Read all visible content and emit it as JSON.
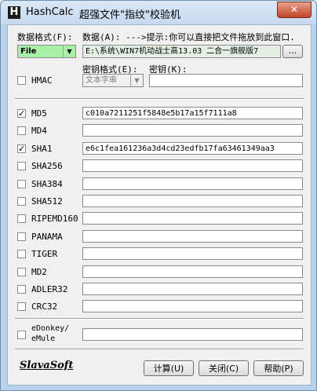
{
  "window": {
    "title": "HashCalc",
    "subtitle": "超强文件\"指纹\"校验机",
    "app_icon": "H",
    "close_glyph": "✕"
  },
  "data_format": {
    "label": "数据格式(F):",
    "value": "File"
  },
  "data": {
    "label": "数据(A): --->提示:你可以直接把文件拖放到此窗口.",
    "value": "E:\\系统\\WIN7机动战士高13.03 二合一旗舰版7",
    "browse_label": "..."
  },
  "hmac": {
    "label": "HMAC",
    "checked": false
  },
  "key_format": {
    "label": "密钥格式(E):",
    "value": "文本字串"
  },
  "key": {
    "label": "密钥(K):",
    "value": ""
  },
  "hashes": [
    {
      "label": "MD5",
      "checked": true,
      "value": "c010a7211251f5848e5b17a15f7111a8"
    },
    {
      "label": "MD4",
      "checked": false,
      "value": ""
    },
    {
      "label": "SHA1",
      "checked": true,
      "value": "e6c1fea161236a3d4cd23edfb17fa63461349aa3"
    },
    {
      "label": "SHA256",
      "checked": false,
      "value": ""
    },
    {
      "label": "SHA384",
      "checked": false,
      "value": ""
    },
    {
      "label": "SHA512",
      "checked": false,
      "value": ""
    },
    {
      "label": "RIPEMD160",
      "checked": false,
      "value": ""
    },
    {
      "label": "PANAMA",
      "checked": false,
      "value": ""
    },
    {
      "label": "TIGER",
      "checked": false,
      "value": ""
    },
    {
      "label": "MD2",
      "checked": false,
      "value": ""
    },
    {
      "label": "ADLER32",
      "checked": false,
      "value": ""
    },
    {
      "label": "CRC32",
      "checked": false,
      "value": ""
    }
  ],
  "edonkey": {
    "label_line1": "eDonkey/",
    "label_line2": "eMule",
    "checked": false,
    "value": ""
  },
  "footer": {
    "logo": "SlavaSoft",
    "calculate_label": "计算(U)",
    "close_label": "关闭(C)",
    "help_label": "帮助(P)"
  },
  "colors": {
    "format_select_bg": "#a8f0a8",
    "title_bar": "#c5d9ef",
    "close_button": "#c4442a"
  }
}
